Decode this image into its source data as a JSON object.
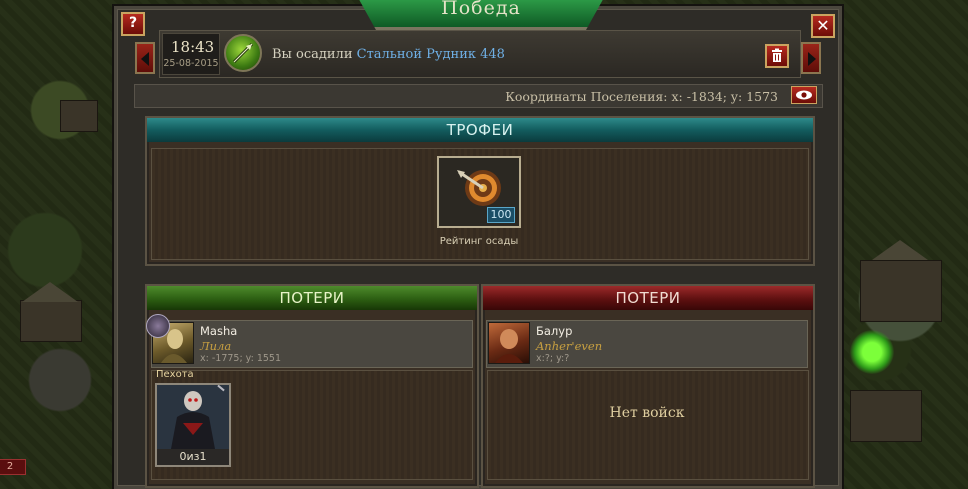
{
  "dialog": {
    "title": "Победа",
    "help_label": "?",
    "close_label": "✕"
  },
  "message": {
    "time": "18:43",
    "date": "25-08-2015",
    "text_prefix": "Вы осадили",
    "target_link": "Стальной Рудник 448"
  },
  "coordinates": {
    "text": "Координаты Поселения: x: -1834; y: 1573"
  },
  "trophies": {
    "header": "ТРОФЕИ",
    "item_value": "100",
    "item_label": "Рейтинг осады"
  },
  "left_losses": {
    "header": "ПОТЕРИ",
    "player_name": "Masha",
    "alliance": "Лила",
    "coords": "x: -1775; y: 1551",
    "unit_type": "Пехота",
    "unit_count": "0из1"
  },
  "right_losses": {
    "header": "ПОТЕРИ",
    "player_name": "Балур",
    "alliance": "Anher'even",
    "coords": "x:?; y:?",
    "empty_text": "Нет войск"
  },
  "map": {
    "badge": "2"
  },
  "colors": {
    "accent_red": "#b62a1f",
    "link_blue": "#6fb0e6",
    "victory_green": "#2fa04a"
  }
}
